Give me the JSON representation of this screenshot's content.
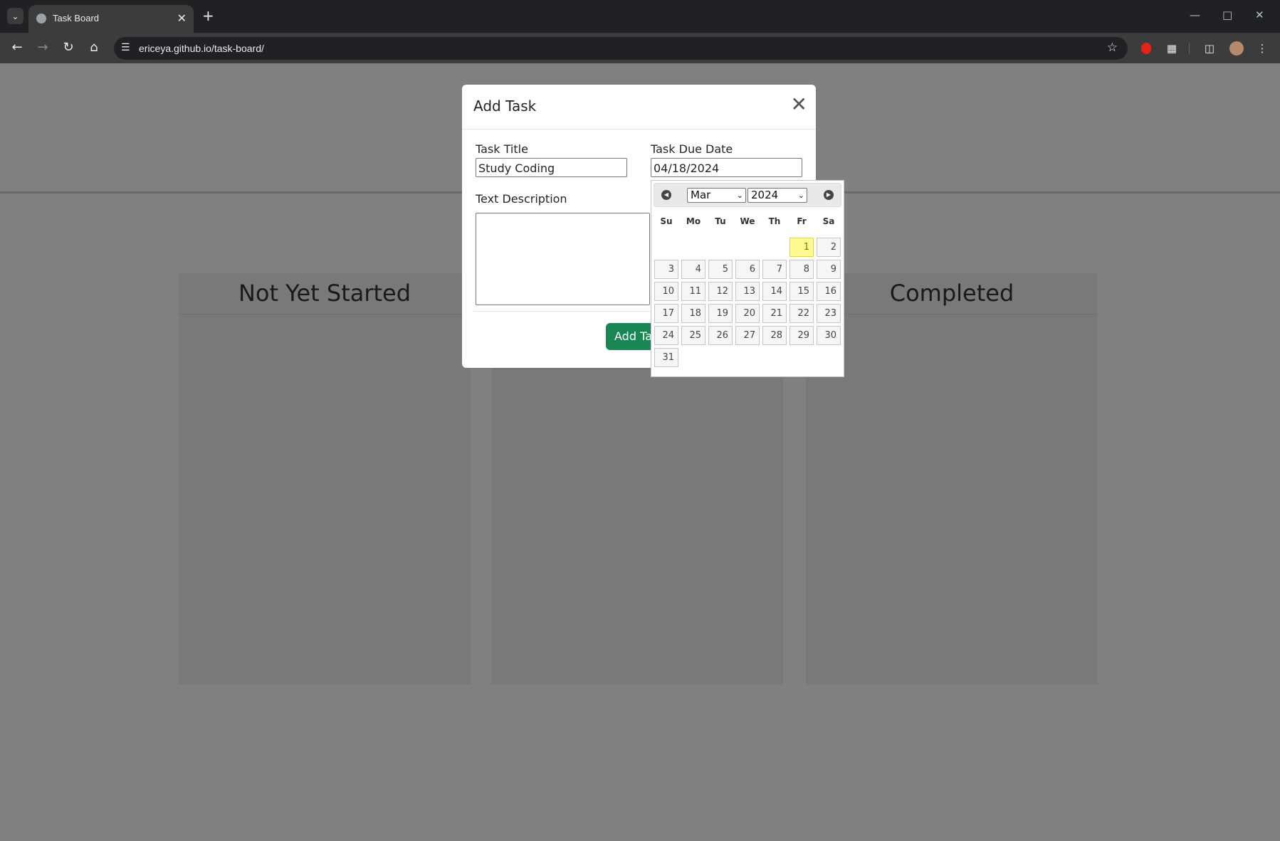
{
  "browser": {
    "tab_title": "Task Board",
    "new_tab_label": "+",
    "url": "ericeya.github.io/task-board/",
    "icons": [
      "tab-list-icon",
      "globe-icon",
      "close-icon",
      "back-icon",
      "forward-icon",
      "reload-icon",
      "home-icon",
      "site-info-icon",
      "star-icon",
      "extension-icon",
      "side-panel-icon",
      "profile-avatar",
      "more-menu-icon",
      "minimize-icon",
      "maximize-icon",
      "window-close-icon"
    ]
  },
  "board": {
    "columns": [
      {
        "title": "Not Yet Started"
      },
      {
        "title": ""
      },
      {
        "title": "Completed"
      }
    ]
  },
  "modal": {
    "title": "Add Task",
    "task_title_label": "Task Title",
    "task_title_value": "Study Coding",
    "due_date_label": "Task Due Date",
    "due_date_value": "04/18/2024",
    "description_label": "Text Description",
    "description_value": "",
    "submit_label": "Add Ta"
  },
  "datepicker": {
    "month": "Mar",
    "year": "2024",
    "weekdays": [
      "Su",
      "Mo",
      "Tu",
      "We",
      "Th",
      "Fr",
      "Sa"
    ],
    "first_weekday_index": 5,
    "days": [
      "1",
      "2",
      "3",
      "4",
      "5",
      "6",
      "7",
      "8",
      "9",
      "10",
      "11",
      "12",
      "13",
      "14",
      "15",
      "16",
      "17",
      "18",
      "19",
      "20",
      "21",
      "22",
      "23",
      "24",
      "25",
      "26",
      "27",
      "28",
      "29",
      "30",
      "31"
    ],
    "highlighted_day": "1",
    "colors": {
      "highlight": "#fffa90",
      "button": "#198754"
    }
  }
}
